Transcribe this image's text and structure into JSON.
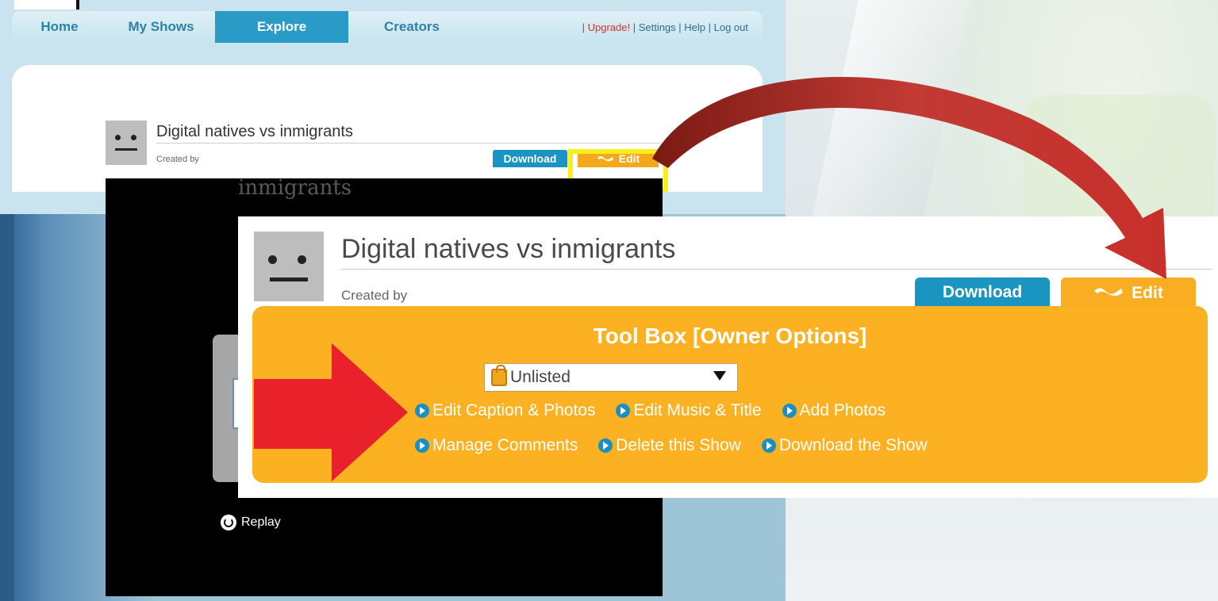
{
  "nav": {
    "tabs": [
      "Home",
      "My Shows",
      "Explore",
      "Creators"
    ],
    "links": {
      "upgrade": "| Upgrade!",
      "settings": " | Settings",
      "help": " | Help",
      "logout": " | Log out"
    }
  },
  "show": {
    "title": "Digital natives vs inmigrants",
    "created_by": "Created by",
    "download_label": "Download",
    "edit_label": "Edit"
  },
  "player": {
    "slide_text": "inmigrants",
    "replay_label": "Replay"
  },
  "toolbox": {
    "title": "Tool Box [Owner Options]",
    "visibility": "Unlisted",
    "options_row1": [
      "Edit Caption & Photos",
      "Edit Music & Title",
      "Add Photos"
    ],
    "options_row2": [
      "Manage Comments",
      "Delete this Show",
      "Download the Show"
    ]
  },
  "colors": {
    "accent_blue": "#1a94c0",
    "edit_orange": "#f9ad22",
    "highlight_yellow": "#f7ee1b",
    "arrow_red": "#e8212b",
    "curve_arrow": "#b8262a"
  }
}
